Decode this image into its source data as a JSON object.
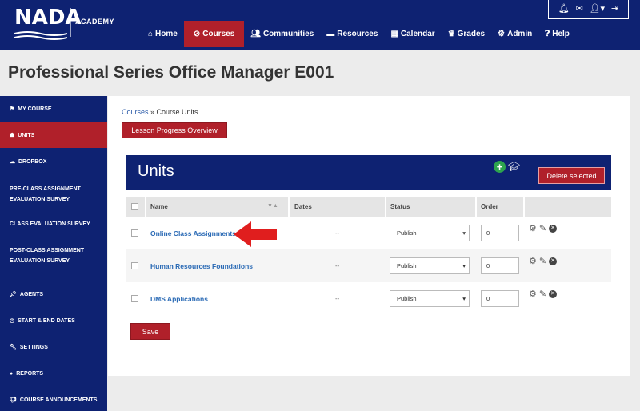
{
  "header": {
    "logo_text": "NADA",
    "logo_sub": "ACADEMY",
    "utility_icons": [
      "bell-icon",
      "envelope-icon",
      "user-icon",
      "signout-icon"
    ],
    "nav": [
      {
        "label": "Home",
        "icon": "home-icon",
        "active": false
      },
      {
        "label": "Courses",
        "icon": "ban-icon",
        "active": true
      },
      {
        "label": "Communities",
        "icon": "users-icon",
        "active": false
      },
      {
        "label": "Resources",
        "icon": "folder-icon",
        "active": false
      },
      {
        "label": "Calendar",
        "icon": "calendar-icon",
        "active": false
      },
      {
        "label": "Grades",
        "icon": "trophy-icon",
        "active": false
      },
      {
        "label": "Admin",
        "icon": "gear-icon",
        "active": false
      },
      {
        "label": "Help",
        "icon": "question-icon",
        "active": false
      }
    ]
  },
  "page_title": "Professional Series Office Manager E001",
  "sidebar": {
    "items": [
      {
        "label": "MY COURSE",
        "icon": "flag-icon",
        "active": false
      },
      {
        "label": "UNITS",
        "icon": "sitemap-icon",
        "active": true
      },
      {
        "label": "DROPBOX",
        "icon": "cloud-icon",
        "active": false
      },
      {
        "label": "PRE-CLASS ASSIGNMENT EVALUATION SURVEY",
        "icon": "",
        "active": false
      },
      {
        "label": "CLASS EVALUATION SURVEY",
        "icon": "",
        "active": false
      },
      {
        "label": "POST-CLASS ASSIGNMENT EVALUATION SURVEY",
        "icon": "",
        "active": false
      },
      {
        "label": "AGENTS",
        "icon": "pin-icon",
        "active": false
      },
      {
        "label": "START & END DATES",
        "icon": "clock-icon",
        "active": false
      },
      {
        "label": "SETTINGS",
        "icon": "wrench-icon",
        "active": false
      },
      {
        "label": "REPORTS",
        "icon": "chart-icon",
        "active": false
      },
      {
        "label": "COURSE ANNOUNCEMENTS",
        "icon": "bullhorn-icon",
        "active": false
      }
    ]
  },
  "breadcrumb": {
    "link": "Courses",
    "separator": " » ",
    "current": "Course Units"
  },
  "buttons": {
    "lesson_progress": "Lesson Progress Overview",
    "delete_selected": "Delete selected",
    "save": "Save"
  },
  "units_panel": {
    "title": "Units"
  },
  "table": {
    "headers": [
      "Name",
      "Dates",
      "Status",
      "Order"
    ],
    "rows": [
      {
        "name": "Online Class Assignments",
        "dates": "--",
        "status": "Publish",
        "order": "0"
      },
      {
        "name": "Human Resources Foundations",
        "dates": "--",
        "status": "Publish",
        "order": "0"
      },
      {
        "name": "DMS Applications",
        "dates": "--",
        "status": "Publish",
        "order": "0"
      }
    ]
  },
  "colors": {
    "navy": "#0e2272",
    "accent_red": "#b0202a",
    "link_blue": "#2a6ab5",
    "arrow_red": "#e01e1e",
    "add_green": "#2da44e"
  }
}
